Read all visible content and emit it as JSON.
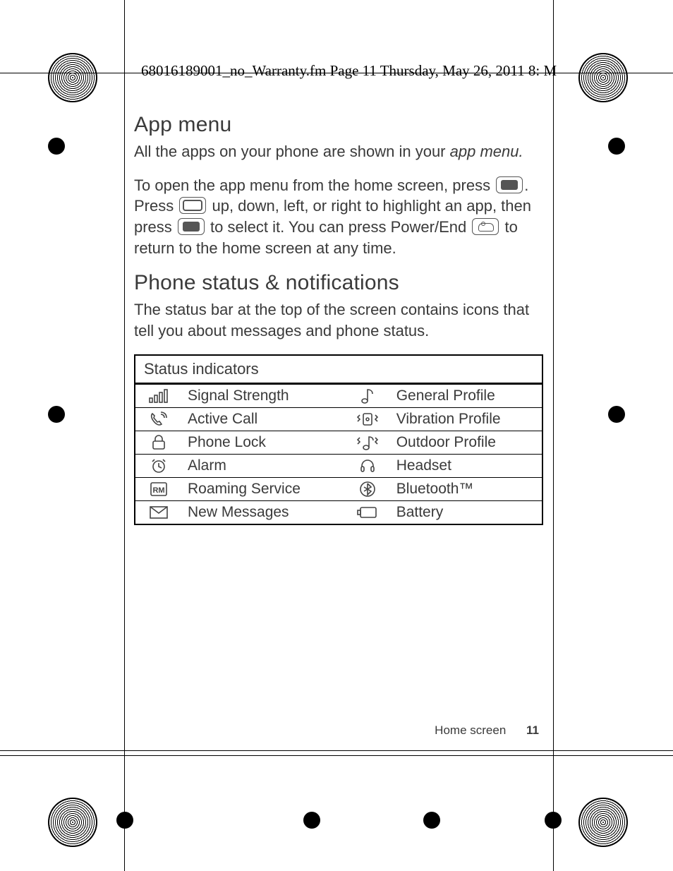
{
  "slug_line": "68016189001_no_Warranty.fm  Page 11  Thursday, May 26, 2011  8:        M",
  "section1": {
    "heading": "App menu",
    "para1_a": "All the apps on your phone are shown in your ",
    "para1_b": "app menu.",
    "para2_a": "To open the app menu from the home screen, press ",
    "para2_b": ". Press ",
    "para2_c": " up, down, left, or right to highlight an app, then press ",
    "para2_d": " to select it. You can press Power/End ",
    "para2_e": " to return to the home screen at any time."
  },
  "section2": {
    "heading": "Phone status & notifications",
    "para": "The status bar at the top of the screen contains icons that tell you about messages and phone status."
  },
  "table": {
    "title": "Status indicators",
    "rows": [
      {
        "left": "Signal Strength",
        "right": "General Profile"
      },
      {
        "left": "Active Call",
        "right": "Vibration Profile"
      },
      {
        "left": "Phone Lock",
        "right": "Outdoor Profile"
      },
      {
        "left": "Alarm",
        "right": "Headset"
      },
      {
        "left": "Roaming Service",
        "right": "Bluetooth™"
      },
      {
        "left": "New Messages",
        "right": "Battery"
      }
    ]
  },
  "footer": {
    "label": "Home screen",
    "page": "11"
  }
}
